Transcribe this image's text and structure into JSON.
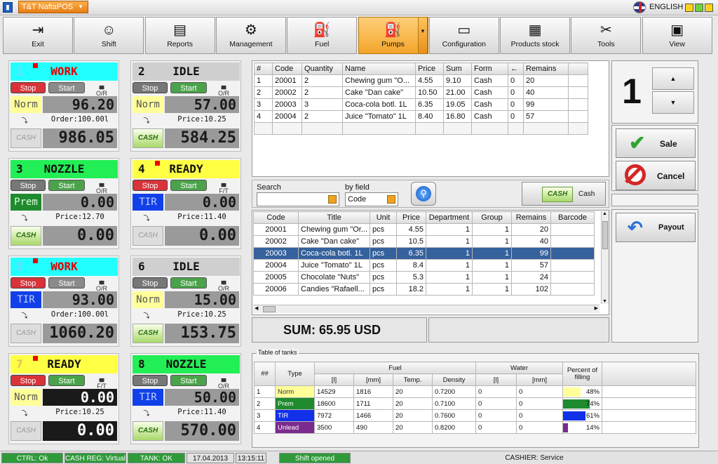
{
  "titlebar": {
    "app_name": "T&T NaftaPOS",
    "language": "ENGLISH"
  },
  "toolbar": [
    {
      "label": "Exit",
      "icon": "exit-icon"
    },
    {
      "label": "Shift",
      "icon": "users-icon"
    },
    {
      "label": "Reports",
      "icon": "reports-icon"
    },
    {
      "label": "Management",
      "icon": "gamepad-icon"
    },
    {
      "label": "Fuel",
      "icon": "fuel-icon"
    },
    {
      "label": "Pumps",
      "icon": "pump-icon"
    },
    {
      "label": "Configuration",
      "icon": "folder-icon"
    },
    {
      "label": "Products stock",
      "icon": "boxes-icon"
    },
    {
      "label": "Tools",
      "icon": "tools-icon"
    },
    {
      "label": "View",
      "icon": "view-icon"
    }
  ],
  "pumps": [
    {
      "num": "1",
      "status": "WORK",
      "fuel": "Norm",
      "volume": "96.20",
      "info": "Order:100.00l",
      "sum": "986.05",
      "stop": "Stop",
      "start": "Start",
      "or": "O/R",
      "cash": "CASH"
    },
    {
      "num": "2",
      "status": "IDLE",
      "fuel": "Norm",
      "volume": "57.00",
      "info": "Price:10.25",
      "sum": "584.25",
      "stop": "Stop",
      "start": "Start",
      "or": "O/R",
      "cash": "CASH"
    },
    {
      "num": "3",
      "status": "NOZZLE",
      "fuel": "Prem",
      "volume": "0.00",
      "info": "Price:12.70",
      "sum": "0.00",
      "stop": "Stop",
      "start": "Start",
      "or": "O/R",
      "cash": "CASH"
    },
    {
      "num": "4",
      "status": "READY",
      "fuel": "TIR",
      "volume": "0.00",
      "info": "Price:11.40",
      "sum": "0.00",
      "stop": "Stop",
      "start": "Start",
      "or": "F/T",
      "cash": "CASH"
    },
    {
      "num": "5",
      "status": "WORK",
      "fuel": "TIR",
      "volume": "93.00",
      "info": "Order:100.00l",
      "sum": "1060.20",
      "stop": "Stop",
      "start": "Start",
      "or": "O/R",
      "cash": "CASH"
    },
    {
      "num": "6",
      "status": "IDLE",
      "fuel": "Norm",
      "volume": "15.00",
      "info": "Price:10.25",
      "sum": "153.75",
      "stop": "Stop",
      "start": "Start",
      "or": "O/R",
      "cash": "CASH"
    },
    {
      "num": "7",
      "status": "READY",
      "fuel": "Norm",
      "volume": "0.00",
      "info": "Price:10.25",
      "sum": "0.00",
      "stop": "Stop",
      "start": "Start",
      "or": "F/T",
      "cash": "CASH"
    },
    {
      "num": "8",
      "status": "NOZZLE",
      "fuel": "TIR",
      "volume": "50.00",
      "info": "Price:11.40",
      "sum": "570.00",
      "stop": "Stop",
      "start": "Start",
      "or": "O/R",
      "cash": "CASH"
    }
  ],
  "receipt": {
    "headers": [
      "#",
      "Code",
      "Quantity",
      "Name",
      "Price",
      "Sum",
      "Form",
      "←",
      "Remains"
    ],
    "rows": [
      [
        "1",
        "20001",
        "2",
        "Chewing gum \"O...",
        "4.55",
        "9.10",
        "Cash",
        "0",
        "20"
      ],
      [
        "2",
        "20002",
        "2",
        "Cake \"Dan cake\"",
        "10.50",
        "21.00",
        "Cash",
        "0",
        "40"
      ],
      [
        "3",
        "20003",
        "3",
        "Coca-cola botl. 1L",
        "6.35",
        "19.05",
        "Cash",
        "0",
        "99"
      ],
      [
        "4",
        "20004",
        "2",
        "Juice \"Tomato\" 1L",
        "8.40",
        "16.80",
        "Cash",
        "0",
        "57"
      ]
    ]
  },
  "quantity_display": "1",
  "search": {
    "label": "Search",
    "by_field_label": "by field",
    "field_value": "Code",
    "cash_label": "Cash",
    "cash_badge": "CASH"
  },
  "products": {
    "headers": [
      "Code",
      "Title",
      "Unit",
      "Price",
      "Department",
      "Group",
      "Remains",
      "Barcode"
    ],
    "rows": [
      [
        "20001",
        "Chewing gum \"Or...",
        "pcs",
        "4.55",
        "1",
        "1",
        "20",
        ""
      ],
      [
        "20002",
        "Cake \"Dan cake\"",
        "pcs",
        "10.5",
        "1",
        "1",
        "40",
        ""
      ],
      [
        "20003",
        "Coca-cola botl. 1L",
        "pcs",
        "6.35",
        "1",
        "1",
        "99",
        ""
      ],
      [
        "20004",
        "Juice \"Tomato\" 1L",
        "pcs",
        "8.4",
        "1",
        "1",
        "57",
        ""
      ],
      [
        "20005",
        "Chocolate \"Nuts\"",
        "pcs",
        "5.3",
        "1",
        "1",
        "24",
        ""
      ],
      [
        "20006",
        "Candies \"Rafaell...",
        "pcs",
        "18.2",
        "1",
        "1",
        "102",
        ""
      ]
    ]
  },
  "sum_text": "SUM: 65.95 USD",
  "buttons": {
    "sale": "Sale",
    "cancel": "Cancel",
    "payout": "Payout"
  },
  "tanks": {
    "legend": "Table of tanks",
    "h_num": "##",
    "h_type": "Type",
    "h_fuel": "Fuel",
    "h_water": "Water",
    "h_pct": "Percent of filling",
    "sub": [
      "[l]",
      "[mm]",
      "Temp.",
      "Density",
      "[l]",
      "[mm]"
    ],
    "rows": [
      {
        "n": "1",
        "type": "Norm",
        "color": "#ffff99",
        "l": "14529",
        "mm": "1816",
        "temp": "20",
        "dens": "0.7200",
        "wl": "0",
        "wmm": "0",
        "pct": "48%",
        "pctv": 0.48,
        "bar": "#ffff99"
      },
      {
        "n": "2",
        "type": "Prem",
        "color": "#1f8a2e",
        "l": "18600",
        "mm": "1711",
        "temp": "20",
        "dens": "0.7100",
        "wl": "0",
        "wmm": "0",
        "pct": "74%",
        "pctv": 0.74,
        "bar": "#1f8a2e"
      },
      {
        "n": "3",
        "type": "TIR",
        "color": "#1230e8",
        "l": "7972",
        "mm": "1466",
        "temp": "20",
        "dens": "0.7600",
        "wl": "0",
        "wmm": "0",
        "pct": "61%",
        "pctv": 0.61,
        "bar": "#1230e8"
      },
      {
        "n": "4",
        "type": "Unlead",
        "color": "#7b2a8e",
        "l": "3500",
        "mm": "490",
        "temp": "20",
        "dens": "0.8200",
        "wl": "0",
        "wmm": "0",
        "pct": "14%",
        "pctv": 0.14,
        "bar": "#7b2a8e"
      }
    ]
  },
  "status": {
    "ctrl": "CTRL: Ok",
    "cashreg": "CASH REG: Virtual",
    "tank": "TANK: OK",
    "date": "17.04.2013",
    "time": "13:15:11",
    "shift": "Shift opened",
    "cashier": "CASHIER: Service"
  }
}
